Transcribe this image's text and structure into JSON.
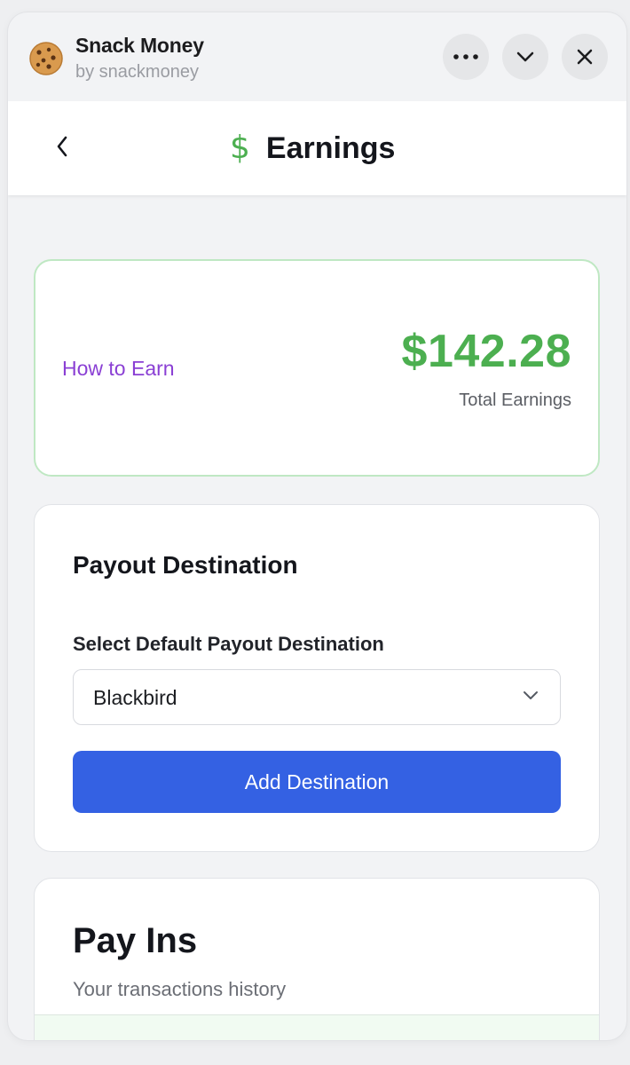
{
  "titlebar": {
    "app_name": "Snack Money",
    "app_by": "by snackmoney",
    "app_icon": "cookie-icon",
    "buttons": [
      "more-icon",
      "chevron-down-icon",
      "close-icon"
    ]
  },
  "header": {
    "title": "Earnings",
    "icon": "dollar-icon",
    "icon_glyph": "$",
    "back_icon": "chevron-left-icon"
  },
  "earnings": {
    "link": "How to Earn",
    "amount": "$142.28",
    "amount_label": "Total Earnings"
  },
  "payout": {
    "title": "Payout Destination",
    "select_label": "Select Default Payout Destination",
    "selected": "Blackbird",
    "button": "Add Destination"
  },
  "payins": {
    "title": "Pay Ins",
    "subtitle": "Your transactions history"
  },
  "colors": {
    "accent_green": "#4caf50",
    "link_purple": "#8a3fd4",
    "primary_blue": "#3461e3"
  }
}
